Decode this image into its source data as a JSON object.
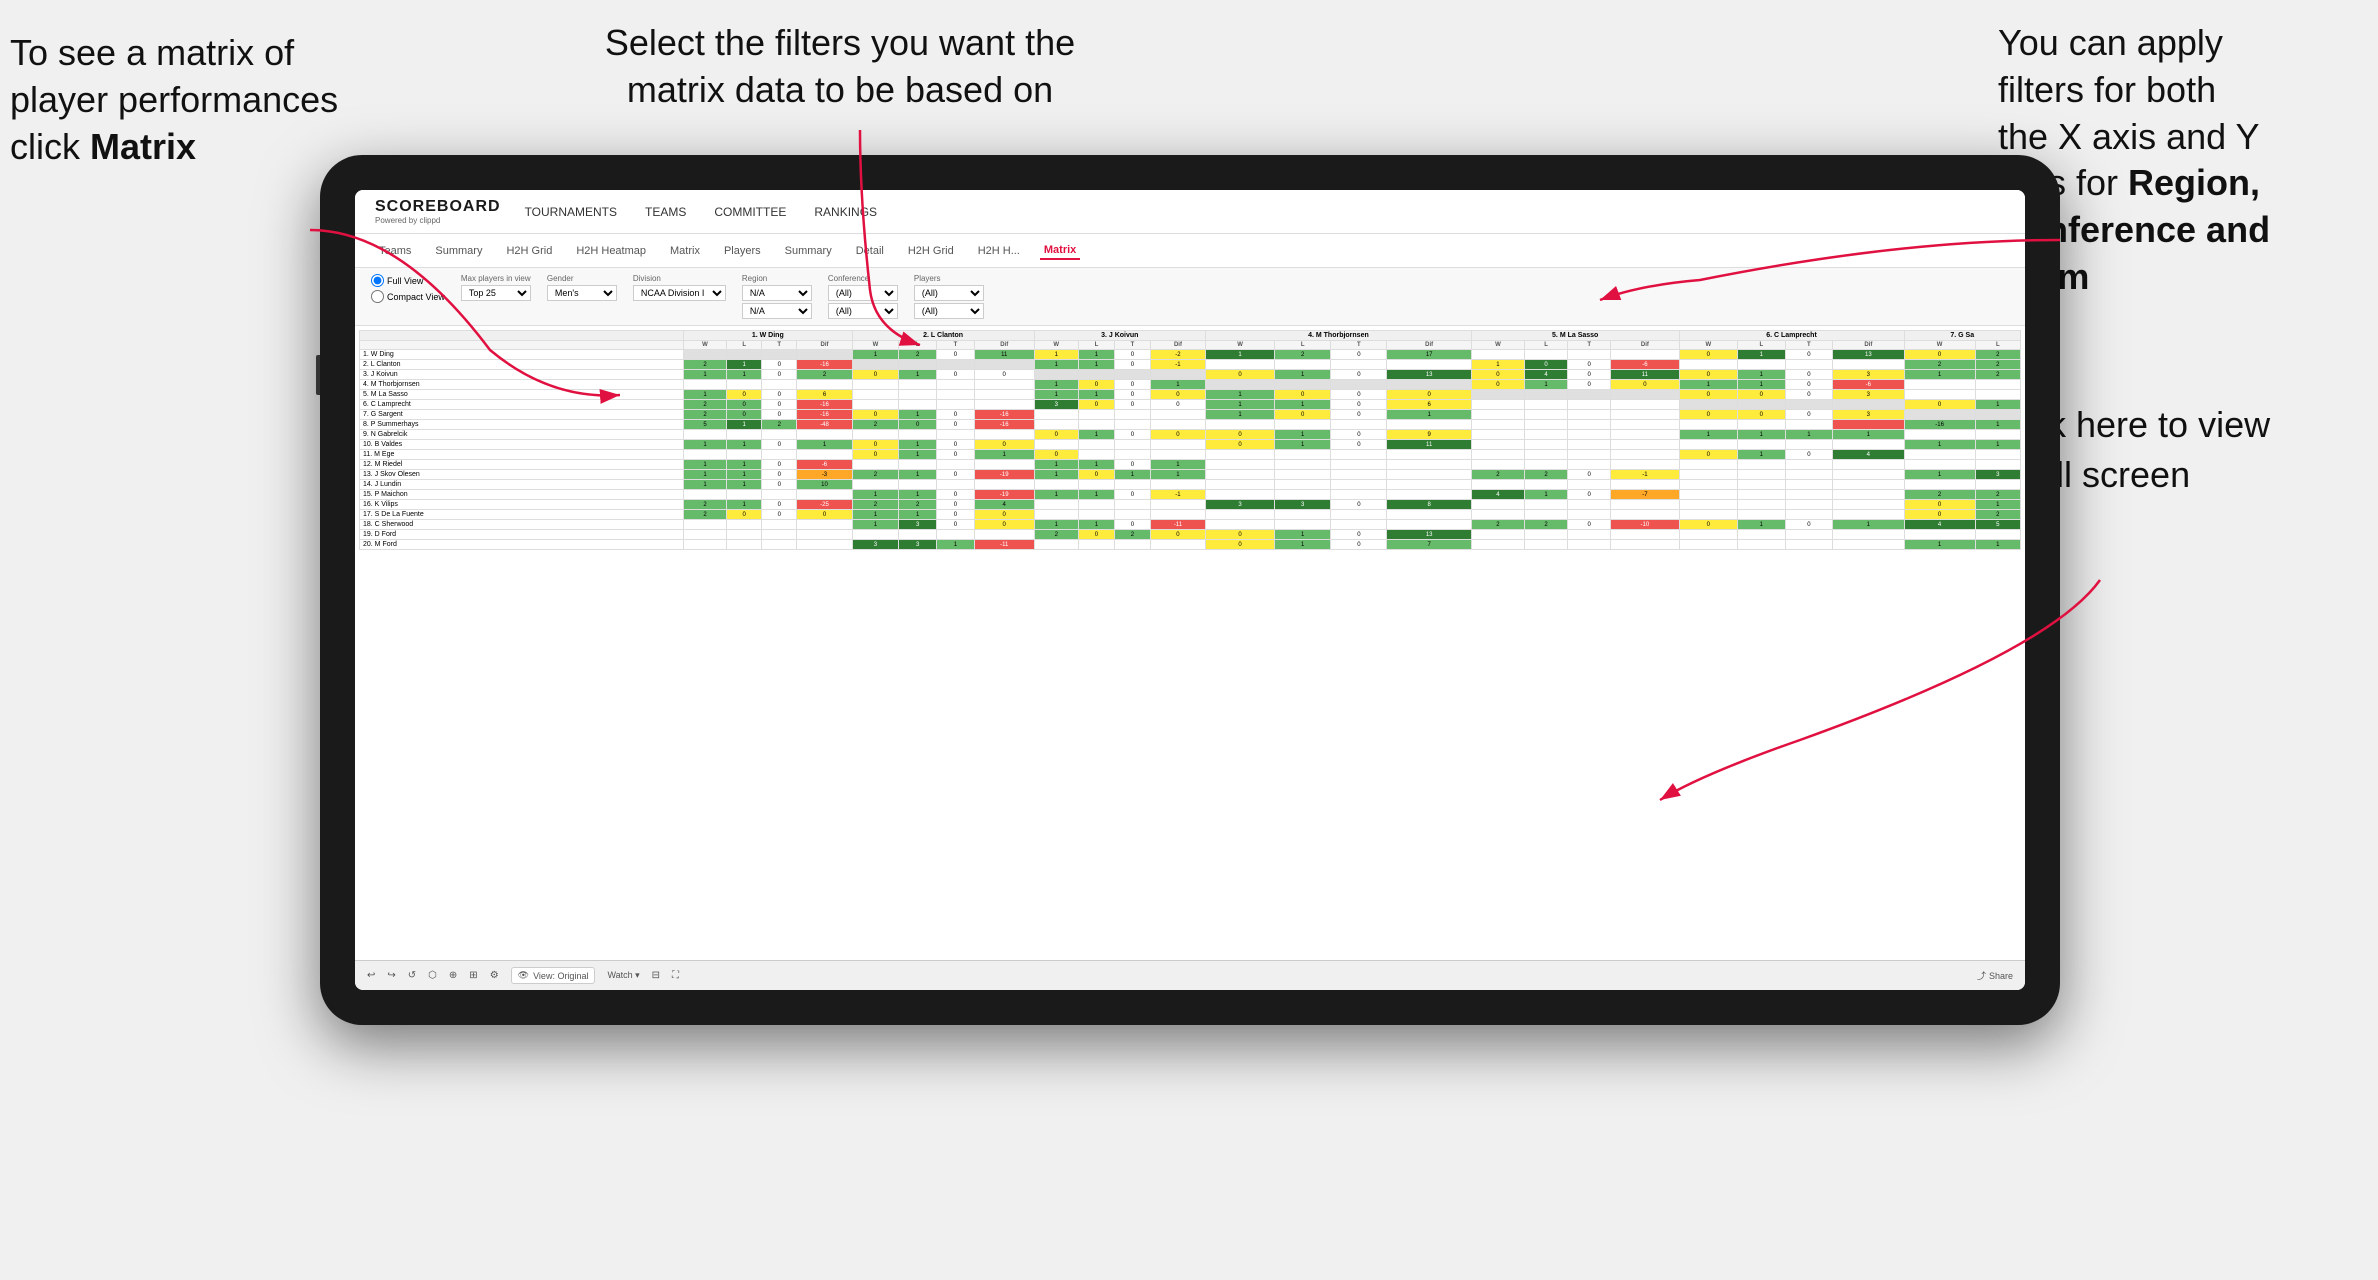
{
  "annotations": {
    "left": {
      "line1": "To see a matrix of",
      "line2": "player performances",
      "line3_prefix": "click ",
      "line3_bold": "Matrix"
    },
    "center": {
      "text": "Select the filters you want the matrix data to be based on"
    },
    "right_top": {
      "line1": "You  can apply",
      "line2": "filters for both",
      "line3": "the X axis and Y",
      "line4_prefix": "Axis for ",
      "line4_bold": "Region,",
      "line5_bold": "Conference and",
      "line6_bold": "Team"
    },
    "right_bottom": {
      "line1": "Click here to view",
      "line2": "in full screen"
    }
  },
  "nav": {
    "logo": "SCOREBOARD",
    "logo_sub": "Powered by clippd",
    "items": [
      "TOURNAMENTS",
      "TEAMS",
      "COMMITTEE",
      "RANKINGS"
    ]
  },
  "subnav": {
    "items": [
      "Teams",
      "Summary",
      "H2H Grid",
      "H2H Heatmap",
      "Matrix",
      "Players",
      "Summary",
      "Detail",
      "H2H Grid",
      "H2H H...",
      "Matrix"
    ],
    "active_index": 10
  },
  "filters": {
    "view_full": "Full View",
    "view_compact": "Compact View",
    "max_players_label": "Max players in view",
    "max_players_value": "Top 25",
    "gender_label": "Gender",
    "gender_value": "Men's",
    "division_label": "Division",
    "division_value": "NCAA Division I",
    "region_label": "Region",
    "region_value1": "N/A",
    "region_value2": "N/A",
    "conference_label": "Conference",
    "conference_value1": "(All)",
    "conference_value2": "(All)",
    "players_label": "Players",
    "players_value1": "(All)",
    "players_value2": "(All)"
  },
  "matrix": {
    "column_headers": [
      "1. W Ding",
      "2. L Clanton",
      "3. J Koivun",
      "4. M Thorbjornsen",
      "5. M La Sasso",
      "6. C Lamprecht",
      "7. G Sa"
    ],
    "sub_headers": [
      "W",
      "L",
      "T",
      "Dif"
    ],
    "rows": [
      {
        "name": "1. W Ding",
        "stats": ""
      },
      {
        "name": "2. L Clanton",
        "stats": ""
      },
      {
        "name": "3. J Koivun",
        "stats": ""
      },
      {
        "name": "4. M Thorbjornsen",
        "stats": ""
      },
      {
        "name": "5. M La Sasso",
        "stats": ""
      },
      {
        "name": "6. C Lamprecht",
        "stats": ""
      },
      {
        "name": "7. G Sargent",
        "stats": ""
      },
      {
        "name": "8. P Summerhays",
        "stats": ""
      },
      {
        "name": "9. N Gabrelcik",
        "stats": ""
      },
      {
        "name": "10. B Valdes",
        "stats": ""
      },
      {
        "name": "11. M Ege",
        "stats": ""
      },
      {
        "name": "12. M Riedel",
        "stats": ""
      },
      {
        "name": "13. J Skov Olesen",
        "stats": ""
      },
      {
        "name": "14. J Lundin",
        "stats": ""
      },
      {
        "name": "15. P Maichon",
        "stats": ""
      },
      {
        "name": "16. K Vilips",
        "stats": ""
      },
      {
        "name": "17. S De La Fuente",
        "stats": ""
      },
      {
        "name": "18. C Sherwood",
        "stats": ""
      },
      {
        "name": "19. D Ford",
        "stats": ""
      },
      {
        "name": "20. M Ford",
        "stats": ""
      }
    ]
  },
  "bottom_bar": {
    "view_label": "View: Original",
    "watch_label": "Watch",
    "share_label": "Share"
  }
}
